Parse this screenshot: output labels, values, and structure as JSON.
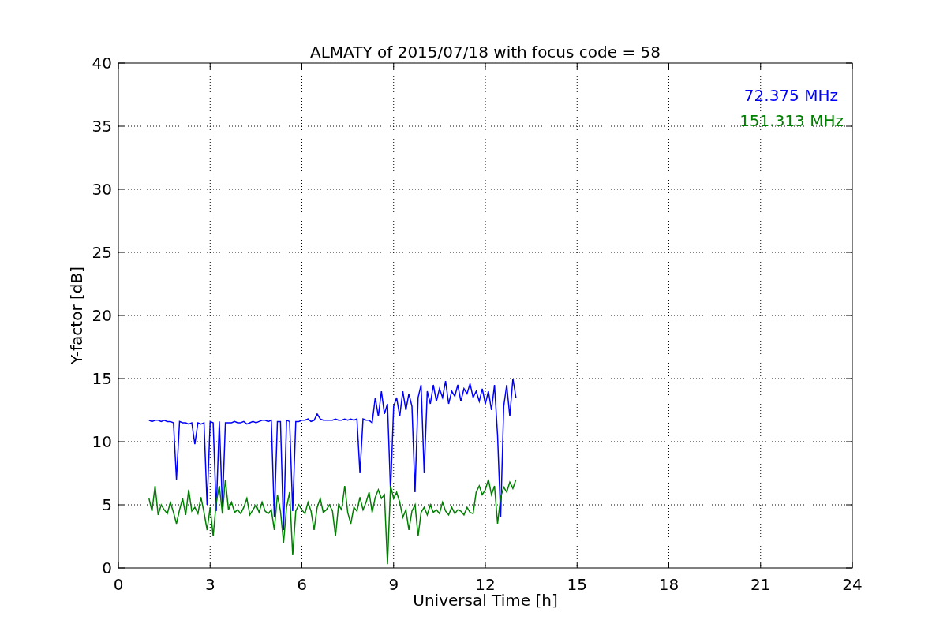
{
  "chart_data": {
    "type": "line",
    "title": "ALMATY of 2015/07/18 with focus code = 58",
    "xlabel": "Universal Time [h]",
    "ylabel": "Y-factor [dB]",
    "xlim": [
      0,
      24
    ],
    "ylim": [
      0,
      40
    ],
    "xticks": [
      0,
      3,
      6,
      9,
      12,
      15,
      18,
      21,
      24
    ],
    "yticks": [
      0,
      5,
      10,
      15,
      20,
      25,
      30,
      35,
      40
    ],
    "grid": true,
    "x": [
      1.0,
      1.1,
      1.2,
      1.3,
      1.4,
      1.5,
      1.6,
      1.7,
      1.8,
      1.9,
      2.0,
      2.1,
      2.2,
      2.3,
      2.4,
      2.5,
      2.6,
      2.7,
      2.8,
      2.9,
      3.0,
      3.1,
      3.2,
      3.3,
      3.4,
      3.5,
      3.6,
      3.7,
      3.8,
      3.9,
      4.0,
      4.1,
      4.2,
      4.3,
      4.4,
      4.5,
      4.6,
      4.7,
      4.8,
      4.9,
      5.0,
      5.1,
      5.2,
      5.3,
      5.4,
      5.5,
      5.6,
      5.7,
      5.8,
      5.9,
      6.0,
      6.1,
      6.2,
      6.3,
      6.4,
      6.5,
      6.6,
      6.7,
      6.8,
      6.9,
      7.0,
      7.1,
      7.2,
      7.3,
      7.4,
      7.5,
      7.6,
      7.7,
      7.8,
      7.9,
      8.0,
      8.1,
      8.2,
      8.3,
      8.4,
      8.5,
      8.6,
      8.7,
      8.8,
      8.9,
      9.0,
      9.1,
      9.2,
      9.3,
      9.4,
      9.5,
      9.6,
      9.7,
      9.8,
      9.9,
      10.0,
      10.1,
      10.2,
      10.3,
      10.4,
      10.5,
      10.6,
      10.7,
      10.8,
      10.9,
      11.0,
      11.1,
      11.2,
      11.3,
      11.4,
      11.5,
      11.6,
      11.7,
      11.8,
      11.9,
      12.0,
      12.1,
      12.2,
      12.3,
      12.4,
      12.5,
      12.6,
      12.7,
      12.8,
      12.9,
      13.0
    ],
    "series": [
      {
        "name": "72.375 MHz",
        "color": "#0000ff",
        "values": [
          11.7,
          11.6,
          11.7,
          11.7,
          11.6,
          11.7,
          11.6,
          11.6,
          11.5,
          7.0,
          11.6,
          11.5,
          11.5,
          11.4,
          11.5,
          9.8,
          11.5,
          11.4,
          11.5,
          5.0,
          11.6,
          11.5,
          4.5,
          11.6,
          4.8,
          11.5,
          11.5,
          11.5,
          11.6,
          11.5,
          11.5,
          11.6,
          11.4,
          11.5,
          11.6,
          11.5,
          11.6,
          11.7,
          11.7,
          11.6,
          11.7,
          4.0,
          11.6,
          11.6,
          3.0,
          11.7,
          11.6,
          4.5,
          11.6,
          11.6,
          11.7,
          11.7,
          11.8,
          11.6,
          11.7,
          12.2,
          11.8,
          11.7,
          11.7,
          11.7,
          11.7,
          11.8,
          11.7,
          11.7,
          11.8,
          11.7,
          11.8,
          11.7,
          11.8,
          7.5,
          11.8,
          11.7,
          11.7,
          11.5,
          13.5,
          12.0,
          14.0,
          12.2,
          13.0,
          6.0,
          12.8,
          13.5,
          12.0,
          14.0,
          12.5,
          13.8,
          12.8,
          6.0,
          13.5,
          14.5,
          7.5,
          14.0,
          13.0,
          14.5,
          13.2,
          14.2,
          13.5,
          14.8,
          13.0,
          14.0,
          13.6,
          14.5,
          13.2,
          14.2,
          13.8,
          14.6,
          13.5,
          14.0,
          13.2,
          14.2,
          13.0,
          14.0,
          12.5,
          14.5,
          10.5,
          4.0,
          12.8,
          14.5,
          12.0,
          15.0,
          13.5
        ]
      },
      {
        "name": "151.313 MHz",
        "color": "#008000",
        "values": [
          5.5,
          4.5,
          6.5,
          4.2,
          5.0,
          4.6,
          4.3,
          5.2,
          4.4,
          3.5,
          4.6,
          5.5,
          4.2,
          6.2,
          4.5,
          4.8,
          4.3,
          5.6,
          4.4,
          3.0,
          4.8,
          2.5,
          5.2,
          6.5,
          4.3,
          7.0,
          4.6,
          5.2,
          4.4,
          4.6,
          4.3,
          4.8,
          5.5,
          4.2,
          4.6,
          5.0,
          4.4,
          5.2,
          4.5,
          4.3,
          4.6,
          3.0,
          5.8,
          4.5,
          2.0,
          4.8,
          6.0,
          1.0,
          4.5,
          5.0,
          4.6,
          4.3,
          5.2,
          4.5,
          3.0,
          4.8,
          5.5,
          4.4,
          4.6,
          5.0,
          4.5,
          2.5,
          5.0,
          4.6,
          6.5,
          4.4,
          3.5,
          4.8,
          4.5,
          5.6,
          4.6,
          5.2,
          6.0,
          4.4,
          5.6,
          6.2,
          5.5,
          5.8,
          0.3,
          6.5,
          5.5,
          6.0,
          5.2,
          4.0,
          4.6,
          3.0,
          4.5,
          5.0,
          2.5,
          4.4,
          4.8,
          4.2,
          5.0,
          4.4,
          4.6,
          4.3,
          5.2,
          4.5,
          4.2,
          4.8,
          4.3,
          4.6,
          4.5,
          4.2,
          4.8,
          4.4,
          4.3,
          6.0,
          6.5,
          5.8,
          6.2,
          7.0,
          5.8,
          6.5,
          3.5,
          5.6,
          6.4,
          6.0,
          6.8,
          6.3,
          7.0
        ]
      }
    ]
  }
}
